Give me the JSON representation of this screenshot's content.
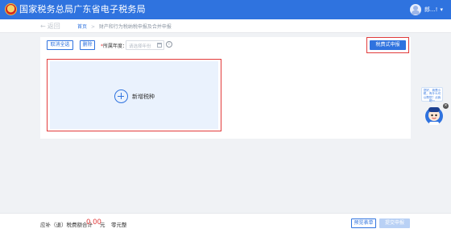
{
  "header": {
    "title": "国家税务总局广东省电子税务局",
    "user_name": "郎...!",
    "bg_color": "#2f73df"
  },
  "breadcrumb": {
    "back_label": "返回",
    "home": "首页",
    "separator": ">",
    "current": "财产和行为税纳税申报及合并申报"
  },
  "toolbar": {
    "cancel_select_label": "取消全选",
    "delete_label": "删除",
    "year_label": "所属年度：",
    "year_placeholder": "请选择年份",
    "report_button_label": "税费式申报"
  },
  "add_tax": {
    "label": "新增税种"
  },
  "assistant": {
    "bubble_text": "您好，我是小税，有什么可以帮您？点我吧～",
    "close_symbol": "×"
  },
  "footer": {
    "total_label": "应补（退）税费额合计",
    "total_amount": "0.00",
    "unit": "元",
    "amount_words": "零元整",
    "preview_label": "预览表单",
    "submit_label": "提交申报"
  }
}
